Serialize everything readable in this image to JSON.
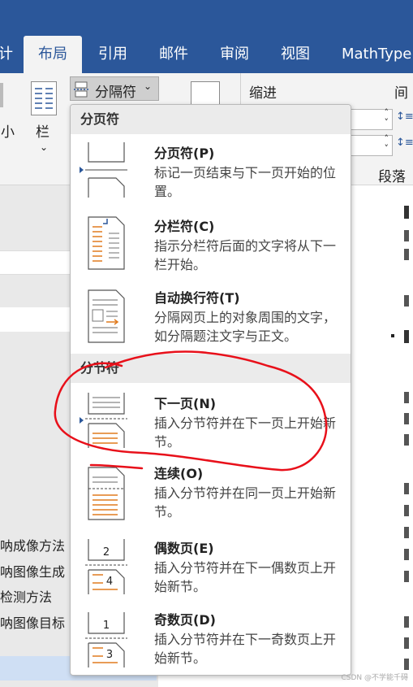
{
  "ribbon_tabs": [
    "计",
    "布局",
    "引用",
    "邮件",
    "审阅",
    "视图",
    "MathType"
  ],
  "ribbon": {
    "breaks_button": "分隔符",
    "size_label": "小",
    "columns_label": "栏",
    "indent_label": "缩进",
    "spacing_label": "间",
    "paragraph_label": "段落"
  },
  "menu": {
    "page_breaks_header": "分页符",
    "section_breaks_header": "分节符",
    "items": [
      {
        "title": "分页符(P)",
        "desc": "标记一页结束与下一页开始的位置。"
      },
      {
        "title": "分栏符(C)",
        "desc": "指示分栏符后面的文字将从下一栏开始。"
      },
      {
        "title": "自动换行符(T)",
        "desc": "分隔网页上的对象周围的文字，如分隔题注文字与正文。"
      },
      {
        "title": "下一页(N)",
        "desc": "插入分节符并在下一页上开始新节。"
      },
      {
        "title": "连续(O)",
        "desc": "插入分节符并在同一页上开始新节。"
      },
      {
        "title": "偶数页(E)",
        "desc": "插入分节符并在下一偶数页上开始新节。"
      },
      {
        "title": "奇数页(D)",
        "desc": "插入分节符并在下一奇数页上开始新节。"
      }
    ],
    "icon_numbers": {
      "even_top": "2",
      "even_bottom": "4",
      "odd_top": "1",
      "odd_bottom": "3"
    }
  },
  "nav_items": [
    "呐成像方法",
    "呐图像生成",
    "检测方法",
    "呐图像目标"
  ],
  "watermark": "CSDN @不学能千碍",
  "accent": "#2b579a",
  "annotation_color": "#e8101a"
}
